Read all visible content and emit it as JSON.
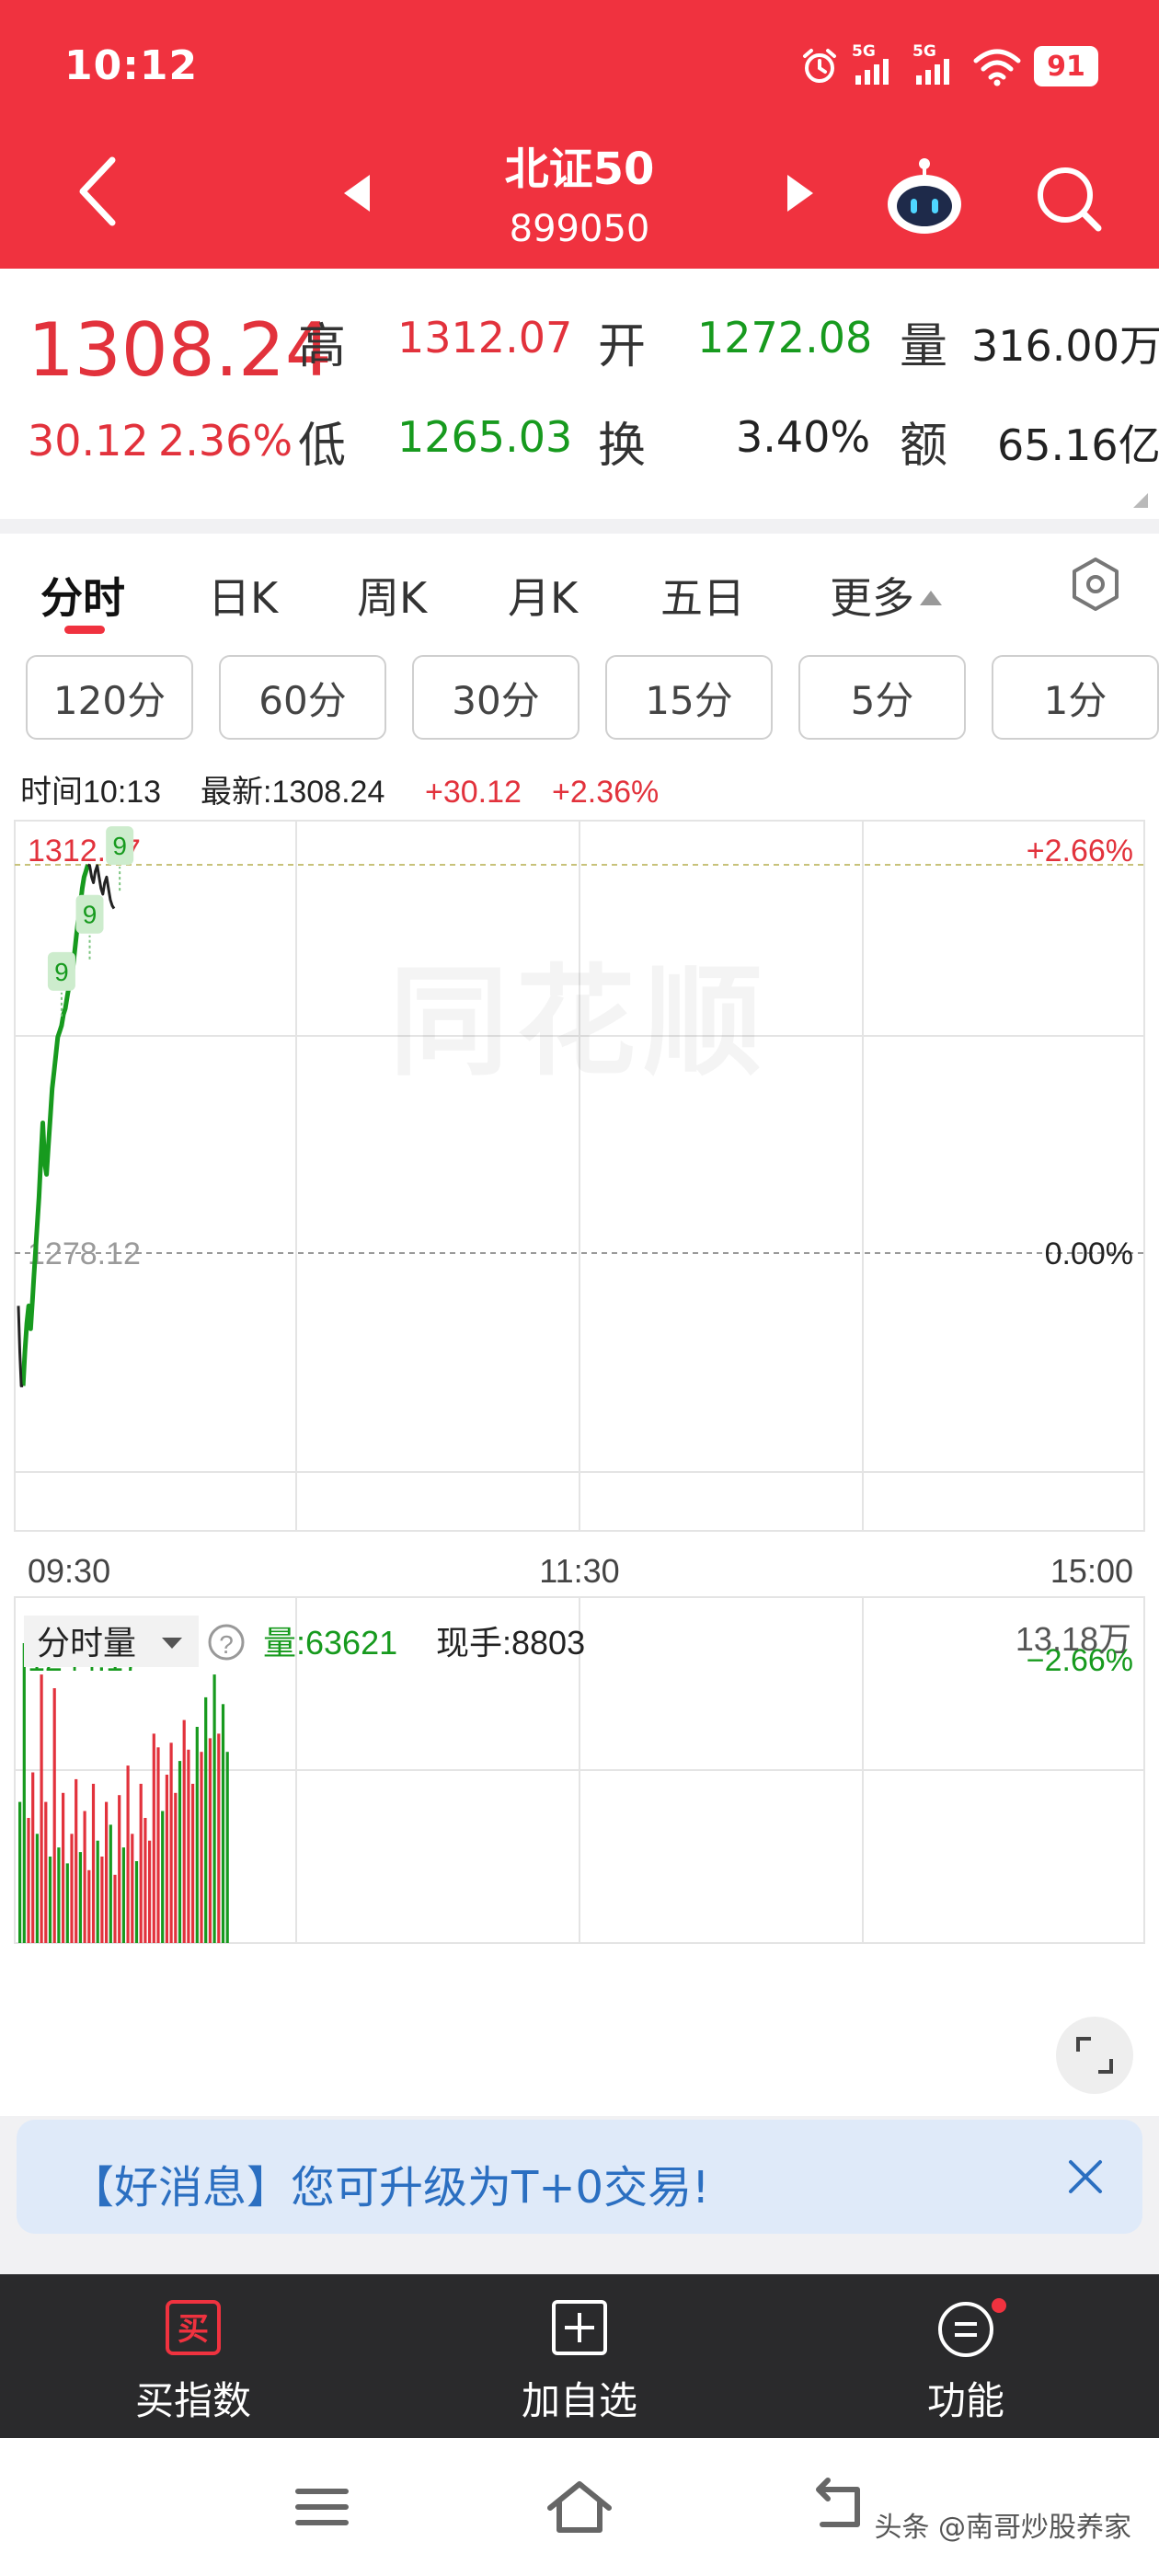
{
  "status": {
    "time": "10:12",
    "signal_label": "5G",
    "battery": "91"
  },
  "header": {
    "title": "北证50",
    "code": "899050"
  },
  "quote": {
    "price": "1308.24",
    "change": "30.12",
    "change_pct": "2.36%",
    "high_label": "高",
    "high": "1312.07",
    "low_label": "低",
    "low": "1265.03",
    "open_label": "开",
    "open": "1272.08",
    "turnover_label": "换",
    "turnover": "3.40%",
    "volume_label": "量",
    "volume": "316.00万",
    "amount_label": "额",
    "amount": "65.16亿"
  },
  "tabs": [
    {
      "label": "分时"
    },
    {
      "label": "日K"
    },
    {
      "label": "周K"
    },
    {
      "label": "月K"
    },
    {
      "label": "五日"
    },
    {
      "label": "更多"
    }
  ],
  "intervals": [
    "120分",
    "60分",
    "30分",
    "15分",
    "5分",
    "1分"
  ],
  "chart_data": {
    "type": "line",
    "info": {
      "time": "时间10:13",
      "latest": "最新:1308.24",
      "change": "+30.12",
      "change_pct": "+2.36%"
    },
    "price_axis": {
      "top": "1312.07",
      "mid": "1278.12",
      "bottom": "1244.17"
    },
    "pct_axis": {
      "top": "+2.66%",
      "mid": "0.00%",
      "bottom": "−2.66%"
    },
    "ylim": [
      1244.17,
      1312.07
    ],
    "time_ticks": [
      "09:30",
      "11:30",
      "15:00"
    ],
    "x_minutes": [
      0,
      0.3,
      0.6,
      1,
      1.4,
      1.8,
      2.2,
      2.6,
      3,
      3.3,
      3.6,
      4,
      4.4,
      4.8,
      5.2,
      5.6,
      6,
      6.4,
      6.8,
      7.2,
      7.6,
      8,
      8.4,
      8.8,
      9.2,
      9.6,
      10,
      10.4,
      10.8,
      11.2,
      11.6,
      12,
      12.4,
      12.8,
      13.2,
      13.6,
      14,
      14.4,
      14.8,
      15.2,
      15.6,
      16,
      16.4,
      16.8,
      17.2,
      17.6,
      18,
      18.4,
      18.8,
      19.2,
      19.6,
      20,
      20.4,
      20.8,
      21.2,
      21.6,
      22,
      22.4,
      22.8,
      23.2,
      23.6,
      24,
      24.4,
      24.8,
      25.2,
      25.6,
      26,
      26.4,
      26.8,
      27.2,
      27.6,
      28,
      28.4,
      28.8,
      29.2,
      29.6,
      30,
      30.4,
      31
    ],
    "price": [
      1273.5,
      1269.5,
      1266.5,
      1266.5,
      1269.5,
      1272.0,
      1273.5,
      1271.5,
      1274.0,
      1276.0,
      1278.0,
      1280.5,
      1283.0,
      1286.5,
      1289.5,
      1286.0,
      1285.0,
      1287.5,
      1290.0,
      1292.5,
      1294.0,
      1295.5,
      1297.0,
      1297.5,
      1298.0,
      1299.0,
      1299.5,
      1300.5,
      1301.5,
      1302.5,
      1303.0,
      1304.5,
      1306.0,
      1307.5,
      1308.5,
      1310.0,
      1311.0,
      1311.5,
      1312.07,
      1312.0,
      1311.0,
      1310.5,
      1311.5,
      1312.0,
      1311.0,
      1310.0,
      1309.5,
      1310.5,
      1311.0,
      1310.0,
      1309.0,
      1308.5,
      1308.24
    ],
    "markers": [
      {
        "label": "9",
        "minute": 9.2,
        "price": 1298.0
      },
      {
        "label": "9",
        "minute": 15.2,
        "price": 1303.0
      },
      {
        "label": "9",
        "minute": 21.6,
        "price": 1309.0
      }
    ],
    "volume": {
      "title": "分时量",
      "vol_text": "量:63621",
      "hand_text": "现手:8803",
      "max_label": "13.18万",
      "max": 131800,
      "bars": [
        62000,
        131800,
        55000,
        75000,
        48000,
        118000,
        62000,
        38000,
        112000,
        42000,
        66000,
        35000,
        48000,
        72000,
        40000,
        58000,
        32000,
        70000,
        45000,
        38000,
        62000,
        52000,
        30000,
        65000,
        42000,
        78000,
        48000,
        36000,
        70000,
        55000,
        45000,
        92000,
        86000,
        58000,
        74000,
        88000,
        66000,
        80000,
        98000,
        85000,
        70000,
        95000,
        84000,
        108000,
        90000,
        118000,
        92000,
        105000,
        84000
      ],
      "colors": [
        "g",
        "g",
        "r",
        "r",
        "g",
        "r",
        "r",
        "g",
        "r",
        "g",
        "r",
        "g",
        "r",
        "r",
        "g",
        "r",
        "r",
        "r",
        "g",
        "r",
        "r",
        "g",
        "r",
        "r",
        "g",
        "r",
        "r",
        "g",
        "r",
        "r",
        "r",
        "r",
        "r",
        "g",
        "r",
        "r",
        "r",
        "g",
        "r",
        "r",
        "r",
        "g",
        "r",
        "g",
        "r",
        "g",
        "r",
        "g",
        "g"
      ]
    }
  },
  "banner": {
    "text": "【好消息】您可升级为T+0交易!"
  },
  "bottom_nav": [
    {
      "label": "买指数",
      "icon_char": "买"
    },
    {
      "label": "加自选"
    },
    {
      "label": "功能"
    }
  ],
  "watermark": "头条 @南哥炒股养家",
  "logo_text": "同花顺",
  "colors": {
    "brand_red": "#f0323f",
    "up": "#e2323c",
    "down": "#179a1e",
    "banner_blue": "#2b6fc1"
  }
}
